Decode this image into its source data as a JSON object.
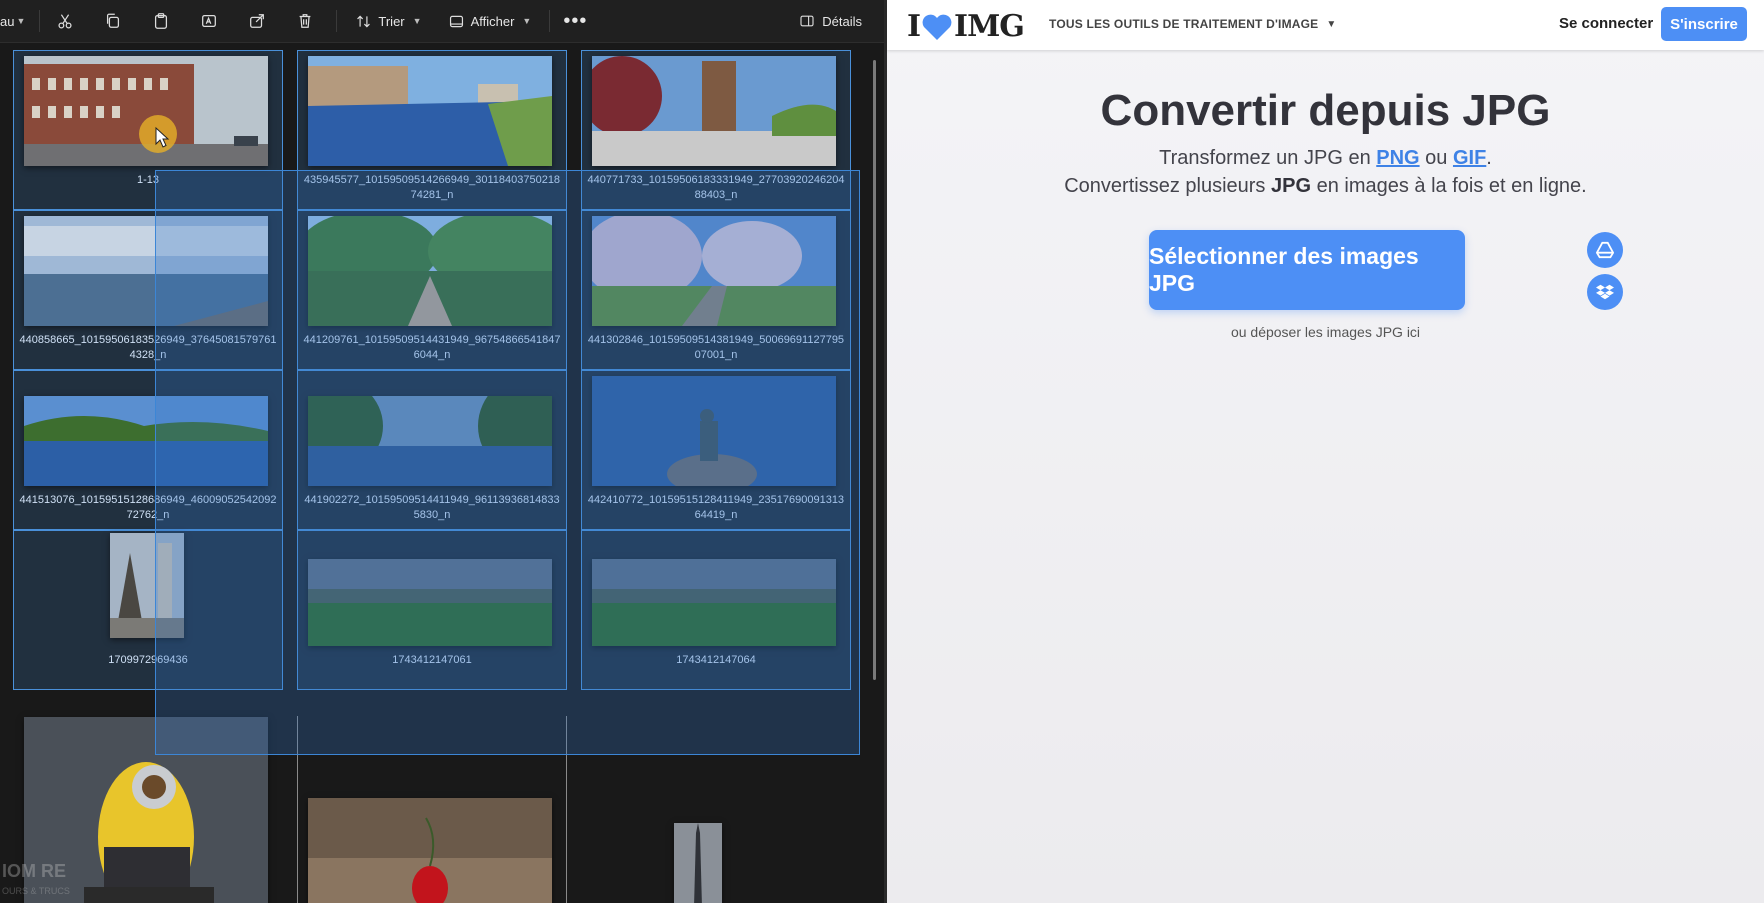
{
  "explorer": {
    "toolbar": {
      "view_partial_label": "au",
      "sort_label": "Trier",
      "view_label": "Afficher",
      "details_label": "Détails"
    },
    "files": [
      {
        "name": "1-13",
        "selected": true
      },
      {
        "name": "435945577_10159509514266949_3011840375021874281_n",
        "selected": true
      },
      {
        "name": "440771733_10159506183331949_2770392024620488403_n",
        "selected": true
      },
      {
        "name": "440858665_10159506183526949_376450815797614328_n",
        "selected": true
      },
      {
        "name": "441209761_10159509514431949_967548665418476044_n",
        "selected": true
      },
      {
        "name": "441302846_10159509514381949_5006969112779507001_n",
        "selected": true
      },
      {
        "name": "441513076_10159515128686949_4600905254209272762_n",
        "selected": true
      },
      {
        "name": "441902272_10159509514411949_961139368148335830_n",
        "selected": true
      },
      {
        "name": "442410772_10159515128411949_2351769009131364419_n",
        "selected": true
      },
      {
        "name": "1709972969436",
        "selected": true
      },
      {
        "name": "1743412147061",
        "selected": true
      },
      {
        "name": "1743412147064",
        "selected": true
      }
    ],
    "watermark": "IOM RE",
    "watermark_sub": "OURS & TRUCS"
  },
  "web": {
    "logo_left": "I",
    "logo_right": "IMG",
    "tools_menu": "TOUS LES OUTILS DE TRAITEMENT D'IMAGE",
    "login": "Se connecter",
    "signup": "S'inscrire",
    "title": "Convertir depuis JPG",
    "sub1_a": "Transformez un JPG en ",
    "sub1_png": "PNG",
    "sub1_b": " ou ",
    "sub1_gif": "GIF",
    "sub1_c": ".",
    "sub2_a": "Convertissez plusieurs ",
    "sub2_jpg": "JPG",
    "sub2_b": " en images à la fois et en ligne.",
    "select_button": "Sélectionner des images JPG",
    "drop_text": "ou déposer les images JPG ici",
    "accent": "#4d8ff5"
  }
}
